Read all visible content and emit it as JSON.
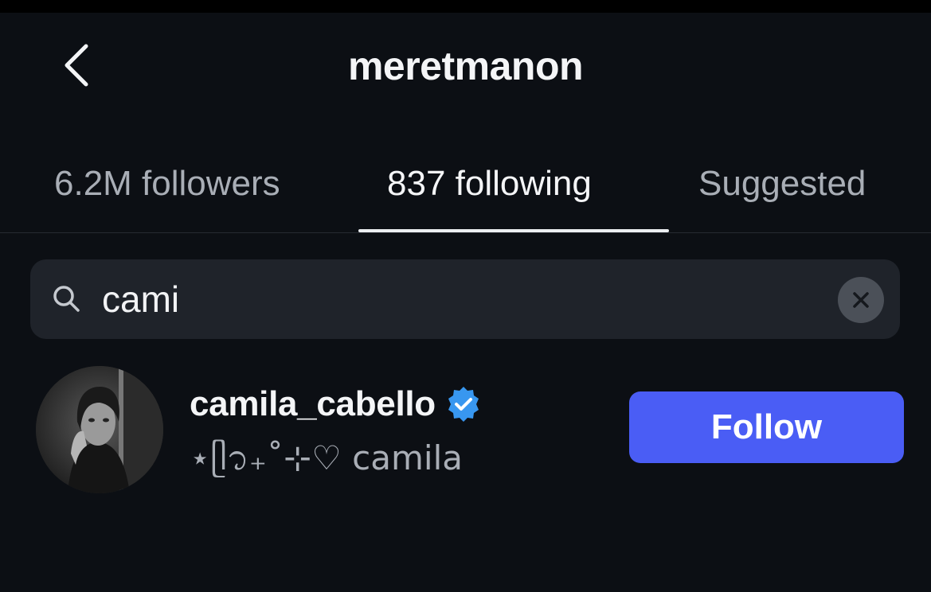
{
  "header": {
    "title": "meretmanon",
    "back_icon": "chevron-left-icon"
  },
  "tabs": [
    {
      "label": "6.2M followers",
      "active": false
    },
    {
      "label": "837 following",
      "active": true
    },
    {
      "label": "Suggested",
      "active": false
    }
  ],
  "search": {
    "value": "cami",
    "icon": "search-icon",
    "clear_icon": "clear-icon"
  },
  "results": [
    {
      "username": "camila_cabello",
      "verified": true,
      "full_name": "⋆ᥫ᭡₊˚⊹♡ camila",
      "button_label": "Follow"
    }
  ],
  "colors": {
    "background": "#0c0f14",
    "search_bg": "#1f232a",
    "follow_button": "#4a5df5",
    "verified_badge": "#3897f0"
  }
}
